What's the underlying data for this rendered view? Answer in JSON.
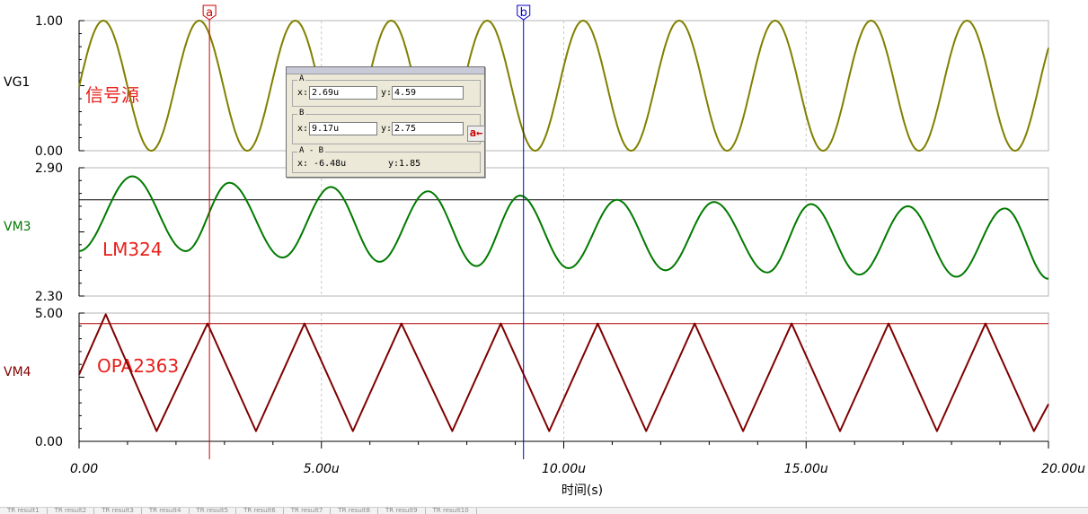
{
  "chart_data": {
    "type": "line",
    "xlabel": "时间(s)",
    "xticks": [
      "0.00",
      "5.00u",
      "10.00u",
      "15.00u",
      "20.00u"
    ],
    "xlim": [
      0,
      20
    ],
    "panels": [
      {
        "name": "VG1",
        "annotation": "信号源",
        "ylim": [
          0.0,
          1.0
        ],
        "yticks": [
          "1.00",
          "0.00"
        ],
        "color": "#808000",
        "waveform": "sine",
        "period": 1.98,
        "peak_time": 0.5,
        "min": 0.0,
        "max": 1.0,
        "reference_level": null
      },
      {
        "name": "VM3",
        "annotation": "LM324",
        "ylim": [
          2.3,
          2.9
        ],
        "yticks": [
          "2.90",
          "2.30"
        ],
        "color": "#007a00",
        "waveform": "sine",
        "x": [
          0,
          1.1,
          2.2,
          3.1,
          4.2,
          5.2,
          6.2,
          7.2,
          8.2,
          9.1,
          10.1,
          11.1,
          12.1,
          13.1,
          14.2,
          15.1,
          16.1,
          17.1,
          18.1,
          19.1,
          20
        ],
        "y": [
          2.51,
          2.86,
          2.51,
          2.83,
          2.48,
          2.81,
          2.46,
          2.79,
          2.44,
          2.77,
          2.43,
          2.75,
          2.42,
          2.74,
          2.41,
          2.73,
          2.4,
          2.72,
          2.39,
          2.71,
          2.38
        ],
        "reference_level": 2.75
      },
      {
        "name": "VM4",
        "annotation": "OPA2363",
        "ylim": [
          0.0,
          5.0
        ],
        "yticks": [
          "5.00",
          "0.00"
        ],
        "color": "#800000",
        "waveform": "triangle",
        "x": [
          0,
          0.55,
          1.6,
          2.65,
          3.65,
          4.65,
          5.65,
          6.65,
          7.7,
          8.7,
          9.7,
          10.7,
          11.7,
          12.7,
          13.7,
          14.7,
          15.7,
          16.7,
          17.7,
          18.7,
          19.7,
          20
        ],
        "y": [
          2.6,
          4.95,
          0.4,
          4.59,
          0.4,
          4.59,
          0.4,
          4.59,
          0.4,
          4.59,
          0.4,
          4.59,
          0.4,
          4.59,
          0.4,
          4.59,
          0.4,
          4.59,
          0.4,
          4.59,
          0.4,
          1.45
        ],
        "reference_level": 4.59
      }
    ],
    "cursors": [
      {
        "label": "a",
        "x": 2.69,
        "color": "#cc0000"
      },
      {
        "label": "b",
        "x": 9.17,
        "color": "#0000cc"
      }
    ],
    "grid": "dashed vertical every 5u"
  },
  "cursor_dialog": {
    "a_group": "A",
    "a_x": "2.69u",
    "a_y": "4.59",
    "b_group": "B",
    "b_x": "9.17u",
    "b_y": "2.75",
    "diff_group": "A - B",
    "diff_x": "x: -6.48u",
    "diff_y": "y:1.85",
    "x_label": "x:",
    "y_label": "y:",
    "swap_label": "a←"
  },
  "bottom_tabs": [
    "TR result1",
    "TR result2",
    "TR result3",
    "TR result4",
    "TR result5",
    "TR result6",
    "TR result7",
    "TR result8",
    "TR result9",
    "TR result10"
  ]
}
